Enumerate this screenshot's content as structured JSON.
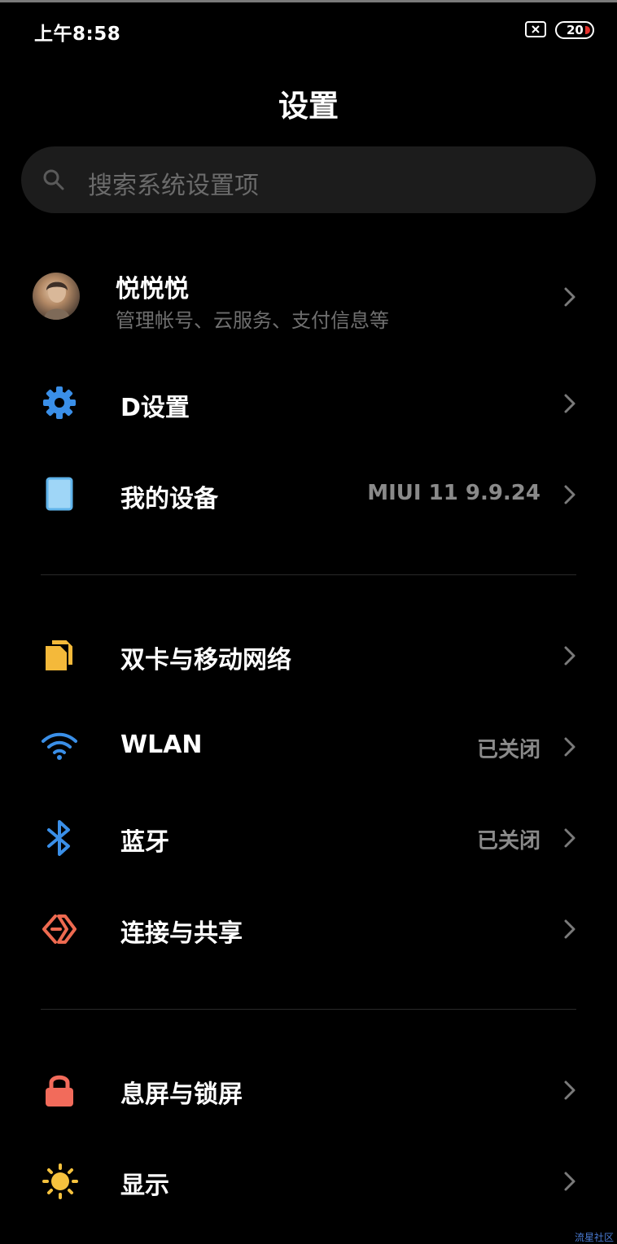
{
  "status_bar": {
    "time": "上午8:58",
    "battery_level": "20",
    "battery_fill_fraction": 0.2,
    "sim_icon": "sim-disabled-icon",
    "battery_color": "#e5312c"
  },
  "header": {
    "title": "设置"
  },
  "search": {
    "placeholder": "搜索系统设置项",
    "icon": "search-icon"
  },
  "account": {
    "name": "悦悦悦",
    "subtitle": "管理帐号、云服务、支付信息等"
  },
  "sections": [
    {
      "items": [
        {
          "label": "D设置",
          "value": "",
          "icon": "gear-icon",
          "icon_color": "#3a8fe8"
        },
        {
          "label": "我的设备",
          "value": "MIUI 11 9.9.24",
          "icon": "tablet-icon",
          "icon_color": "#8fcdf5"
        }
      ]
    },
    {
      "items": [
        {
          "label": "双卡与移动网络",
          "value": "",
          "icon": "sim-cards-icon",
          "icon_color": "#f4b93a"
        },
        {
          "label": "WLAN",
          "value": "已关闭",
          "icon": "wifi-icon",
          "icon_color": "#3a8fe8"
        },
        {
          "label": "蓝牙",
          "value": "已关闭",
          "icon": "bluetooth-icon",
          "icon_color": "#3a8fe8"
        },
        {
          "label": "连接与共享",
          "value": "",
          "icon": "share-connect-icon",
          "icon_color": "#ee6a50"
        }
      ]
    },
    {
      "items": [
        {
          "label": "息屏与锁屏",
          "value": "",
          "icon": "lock-icon",
          "icon_color": "#f26b5b"
        },
        {
          "label": "显示",
          "value": "",
          "icon": "sun-icon",
          "icon_color": "#f6c23e"
        }
      ]
    }
  ],
  "watermark": "流星社区"
}
